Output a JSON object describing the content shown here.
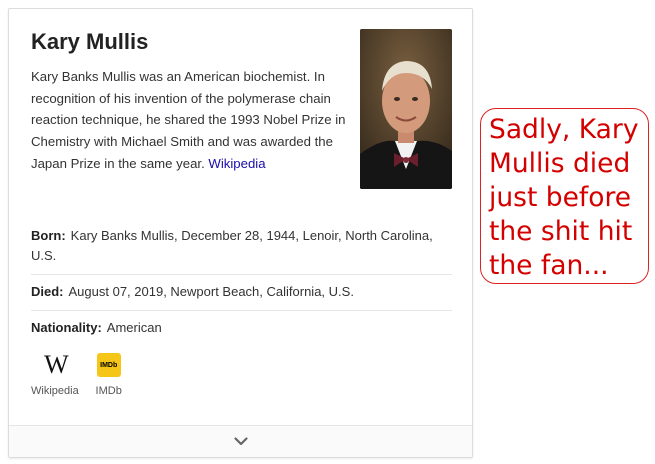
{
  "card": {
    "title": "Kary Mullis",
    "description": "Kary Banks Mullis was an American biochemist. In recognition of his invention of the polymerase chain reaction technique, he shared the 1993 Nobel Prize in Chemistry with Michael Smith and was awarded the Japan Prize in the same year. ",
    "source_link": "Wikipedia",
    "facts": [
      {
        "label": "Born:",
        "value": "Kary Banks Mullis, December 28, 1944, Lenoir, North Carolina, U.S."
      },
      {
        "label": "Died:",
        "value": "August 07, 2019, Newport Beach, California, U.S."
      },
      {
        "label": "Nationality:",
        "value": "American"
      }
    ],
    "links": [
      {
        "label": "Wikipedia",
        "icon": "wikipedia-w-icon",
        "glyph": "W"
      },
      {
        "label": "IMDb",
        "icon": "imdb-icon",
        "glyph": "IMDb"
      }
    ],
    "expand_icon": "chevron-down-icon"
  },
  "annotation": {
    "text": "Sadly, Kary Mullis died just before the shit hit the fan...",
    "color": "#d40000"
  }
}
